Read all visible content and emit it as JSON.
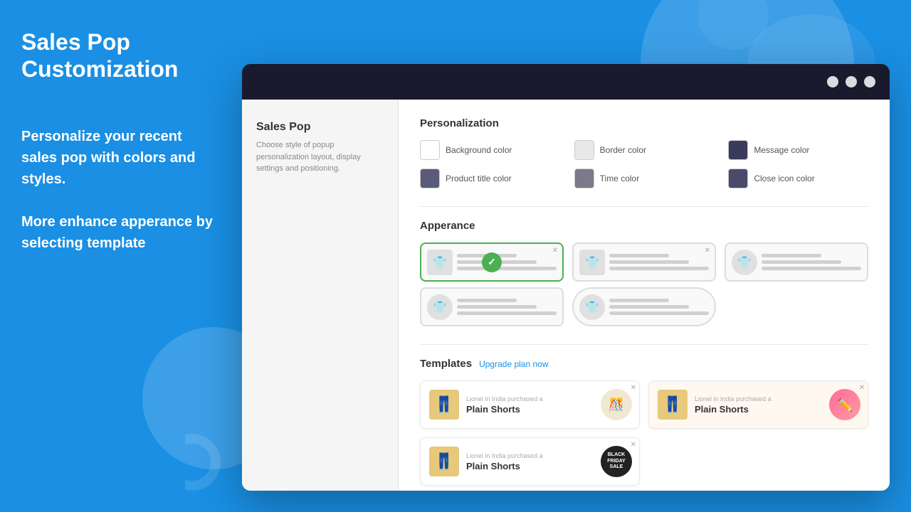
{
  "page": {
    "title": "Sales Pop Customization",
    "left_desc_1": "Personalize your recent sales pop with colors and styles.",
    "left_desc_2": "More enhance apperance by selecting template"
  },
  "window": {
    "titlebar_buttons": [
      "btn1",
      "btn2",
      "btn3"
    ]
  },
  "sidebar": {
    "title": "Sales Pop",
    "description": "Choose style of popup personalization layout, display settings and positioning."
  },
  "personalization": {
    "section_title": "Personalization",
    "colors": [
      {
        "label": "Background color",
        "swatch": "#ffffff"
      },
      {
        "label": "Border color",
        "swatch": "#e8e8e8"
      },
      {
        "label": "Message color",
        "swatch": "#3a3a5c"
      },
      {
        "label": "Product title color",
        "swatch": "#5a5a7a"
      },
      {
        "label": "Time color",
        "swatch": "#7a7a8a"
      },
      {
        "label": "Close icon color",
        "swatch": "#4a4a6a"
      }
    ]
  },
  "appearance": {
    "section_title": "Apperance",
    "templates": [
      {
        "id": 1,
        "selected": true,
        "rounded": false,
        "icon_rounded": false
      },
      {
        "id": 2,
        "selected": false,
        "rounded": false,
        "icon_rounded": false
      },
      {
        "id": 3,
        "selected": false,
        "rounded": false,
        "icon_rounded": true
      },
      {
        "id": 4,
        "selected": false,
        "rounded": false,
        "icon_rounded": true
      },
      {
        "id": 5,
        "selected": false,
        "rounded": true,
        "icon_rounded": true
      }
    ]
  },
  "templates": {
    "section_title": "Templates",
    "upgrade_label": "Upgrade plan now",
    "items": [
      {
        "id": 1,
        "subtitle": "Lionel in India purchased a",
        "product": "Plain Shorts",
        "badge_type": "confetti",
        "highlighted": false
      },
      {
        "id": 2,
        "subtitle": "Lionel in India purchased a",
        "product": "Plain Shorts",
        "badge_type": "pink",
        "highlighted": true
      },
      {
        "id": 3,
        "subtitle": "Lionel in India purchased a",
        "product": "Plain Shorts",
        "badge_type": "black_friday",
        "highlighted": false
      }
    ]
  }
}
